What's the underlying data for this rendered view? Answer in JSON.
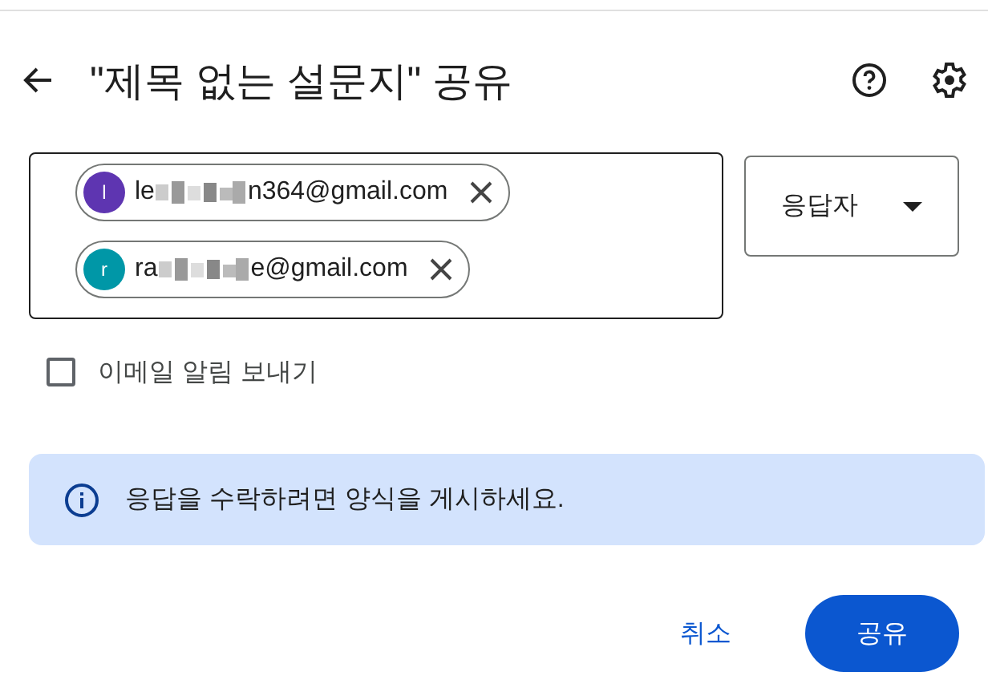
{
  "header": {
    "title": "\"제목 없는 설문지\" 공유"
  },
  "recipients": [
    {
      "avatar": "l",
      "color": "#5e35b1",
      "email_start": "le",
      "email_end": "n364@gmail.com"
    },
    {
      "avatar": "r",
      "color": "#0097a7",
      "email_start": "ra",
      "email_end": "e@gmail.com"
    }
  ],
  "role": {
    "label": "응답자"
  },
  "notify": {
    "label": "이메일 알림 보내기",
    "checked": false
  },
  "banner": {
    "text": "응답을 수락하려면 양식을 게시하세요."
  },
  "buttons": [
    {
      "kind": "text",
      "label": "취소"
    },
    {
      "kind": "filled",
      "label": "공유"
    }
  ]
}
